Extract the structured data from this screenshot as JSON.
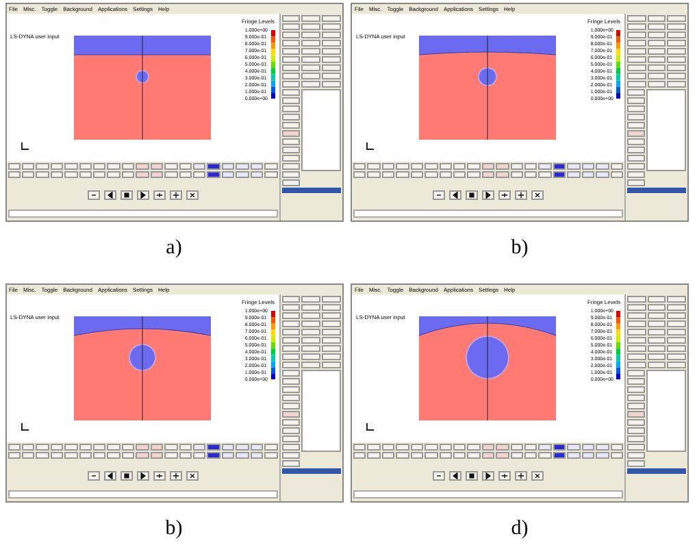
{
  "panels": [
    {
      "caption": "a)",
      "menu": [
        "File",
        "Misc.",
        "Toggle",
        "Background",
        "Applications",
        "Settings",
        "Help"
      ],
      "title": "LS-DYNA user input",
      "legend": {
        "title": "Fringe Levels",
        "values": [
          "1.000e+00",
          "9.000e-01",
          "8.000e-01",
          "7.000e-01",
          "6.000e-01",
          "5.000e-01",
          "4.000e-01",
          "3.000e-01",
          "2.000e-01",
          "1.000e-01",
          "0.000e+00"
        ]
      }
    },
    {
      "caption": "b)",
      "menu": [
        "File",
        "Misc.",
        "Toggle",
        "Background",
        "Applications",
        "Settings",
        "Help"
      ],
      "title": "LS-DYNA user input",
      "legend": {
        "title": "Fringe Levels",
        "values": [
          "1.000e+00",
          "9.000e-01",
          "8.000e-01",
          "7.000e-01",
          "6.000e-01",
          "5.000e-01",
          "4.000e-01",
          "3.000e-01",
          "2.000e-01",
          "1.000e-01",
          "0.000e+00"
        ]
      }
    },
    {
      "caption": "b)",
      "menu": [
        "File",
        "Misc.",
        "Toggle",
        "Background",
        "Applications",
        "Settings",
        "Help"
      ],
      "title": "LS-DYNA user input",
      "legend": {
        "title": "Fringe Levels",
        "values": [
          "1.000e+00",
          "9.000e-01",
          "8.000e-01",
          "7.000e-01",
          "6.000e-01",
          "5.000e-01",
          "4.000e-01",
          "3.000e-01",
          "2.000e-01",
          "1.000e-01",
          "0.000e+00"
        ]
      }
    },
    {
      "caption": "d)",
      "menu": [
        "File",
        "Misc.",
        "Toggle",
        "Background",
        "Applications",
        "Settings",
        "Help"
      ],
      "title": "LS-DYNA user input",
      "legend": {
        "title": "Fringe Levels",
        "values": [
          "1.000e+00",
          "9.000e-01",
          "8.000e-01",
          "7.000e-01",
          "6.000e-01",
          "5.000e-01",
          "4.000e-01",
          "3.000e-01",
          "2.000e-01",
          "1.000e-01",
          "0.000e+00"
        ]
      }
    }
  ]
}
